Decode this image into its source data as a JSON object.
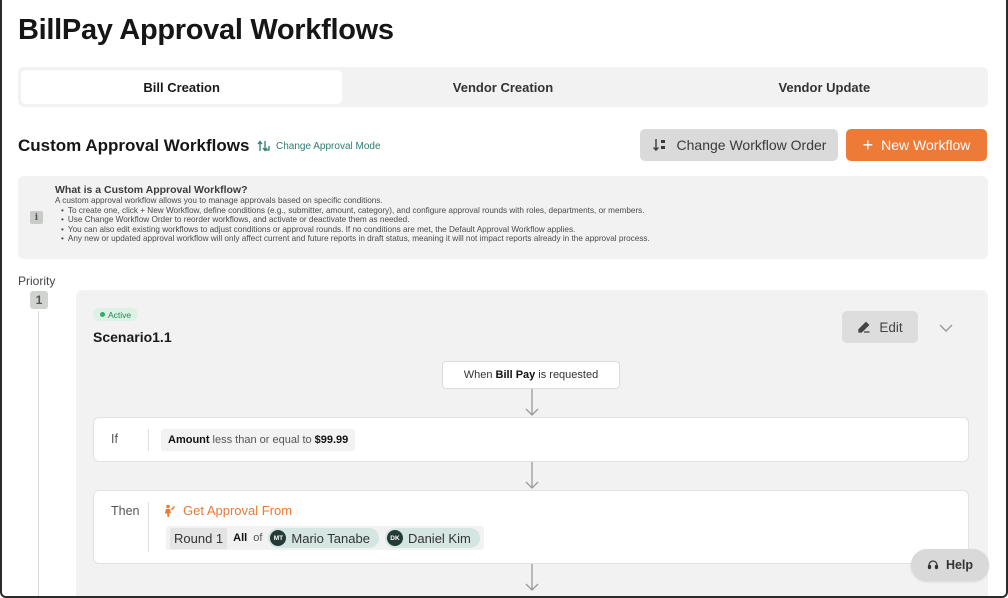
{
  "page": {
    "title": "BillPay Approval Workflows"
  },
  "tabs": [
    {
      "label": "Bill Creation",
      "active": true
    },
    {
      "label": "Vendor Creation",
      "active": false
    },
    {
      "label": "Vendor Update",
      "active": false
    }
  ],
  "section": {
    "title": "Custom Approval Workflows",
    "change_mode_label": "Change Approval Mode",
    "change_order_label": "Change Workflow Order",
    "new_workflow_label": "New Workflow"
  },
  "info": {
    "icon_glyph": "i",
    "heading": "What is a Custom Approval Workflow?",
    "intro": "A custom approval workflow allows you to manage approvals based on specific conditions.",
    "bullets": [
      "To create one, click + New Workflow, define conditions (e.g., submitter, amount, category), and configure approval rounds with roles, departments, or members.",
      "Use Change Workflow Order to reorder workflows, and activate or deactivate them as needed.",
      "You can also edit existing workflows to adjust conditions or approval rounds. If no conditions are met, the Default Approval Workflow applies.",
      "Any new or updated approval workflow will only affect current and future reports in draft status, meaning it will not impact reports already in the approval process."
    ]
  },
  "priority": {
    "label": "Priority",
    "value": "1"
  },
  "workflow": {
    "status": "Active",
    "name": "Scenario1.1",
    "edit_label": "Edit",
    "trigger": {
      "prefix": "When",
      "subject": "Bill Pay",
      "suffix": "is requested"
    },
    "condition": {
      "label": "If",
      "field": "Amount",
      "operator": "less than or equal to",
      "value": "$99.99"
    },
    "action": {
      "label": "Then",
      "title": "Get Approval From",
      "round_label": "Round 1",
      "quantifier": "All",
      "of_label": "of",
      "approvers": [
        {
          "initials": "MT",
          "name": "Mario Tanabe"
        },
        {
          "initials": "DK",
          "name": "Daniel Kim"
        }
      ]
    }
  },
  "help": {
    "label": "Help"
  },
  "colors": {
    "accent": "#ee7a38",
    "teal": "#2d7d70",
    "active_green": "#3aa86b"
  }
}
